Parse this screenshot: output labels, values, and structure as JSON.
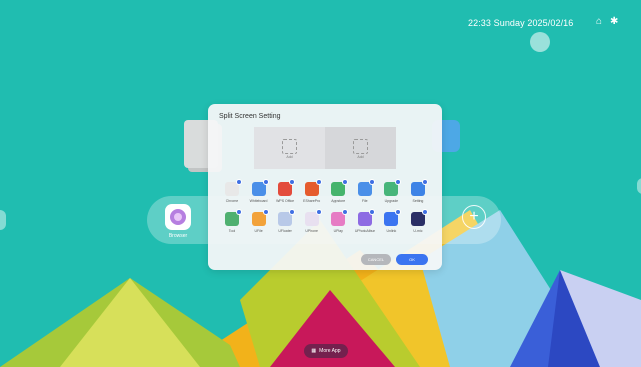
{
  "status_bar": {
    "datetime": "22:33 Sunday 2025/02/16",
    "icons": [
      "wifi-icon",
      "bluetooth-icon"
    ]
  },
  "dock": {
    "browser_label": "Browser"
  },
  "dialog": {
    "title": "Split Screen Setting",
    "slots": [
      "Add",
      "Add"
    ],
    "apps_row1": [
      {
        "label": "Chrome",
        "color": "#e8e8e8"
      },
      {
        "label": "Whiteboard",
        "color": "#4a8fe8"
      },
      {
        "label": "WPS Office",
        "color": "#e34b3b"
      },
      {
        "label": "ESharePro",
        "color": "#e55b2d"
      },
      {
        "label": "Appstore",
        "color": "#45b46c"
      },
      {
        "label": "File",
        "color": "#4a8fe8"
      },
      {
        "label": "Upgrade",
        "color": "#47b57a"
      },
      {
        "label": "Setting",
        "color": "#3d83e6"
      }
    ],
    "apps_row2": [
      {
        "label": "Tool",
        "color": "#4fb070"
      },
      {
        "label": "UFile",
        "color": "#f2a23a"
      },
      {
        "label": "UFloater",
        "color": "#b8c9e8"
      },
      {
        "label": "UPhone",
        "color": "#e8e0f0"
      },
      {
        "label": "UPlay",
        "color": "#e67cc4"
      },
      {
        "label": "UPhotoAlbum",
        "color": "#8d6be3"
      },
      {
        "label": "Unlink",
        "color": "#3b74f0"
      },
      {
        "label": "U-mic",
        "color": "#2b2f66"
      }
    ],
    "cancel_label": "CANCEL",
    "ok_label": "OK"
  },
  "footer": {
    "more_app_label": "More App"
  }
}
